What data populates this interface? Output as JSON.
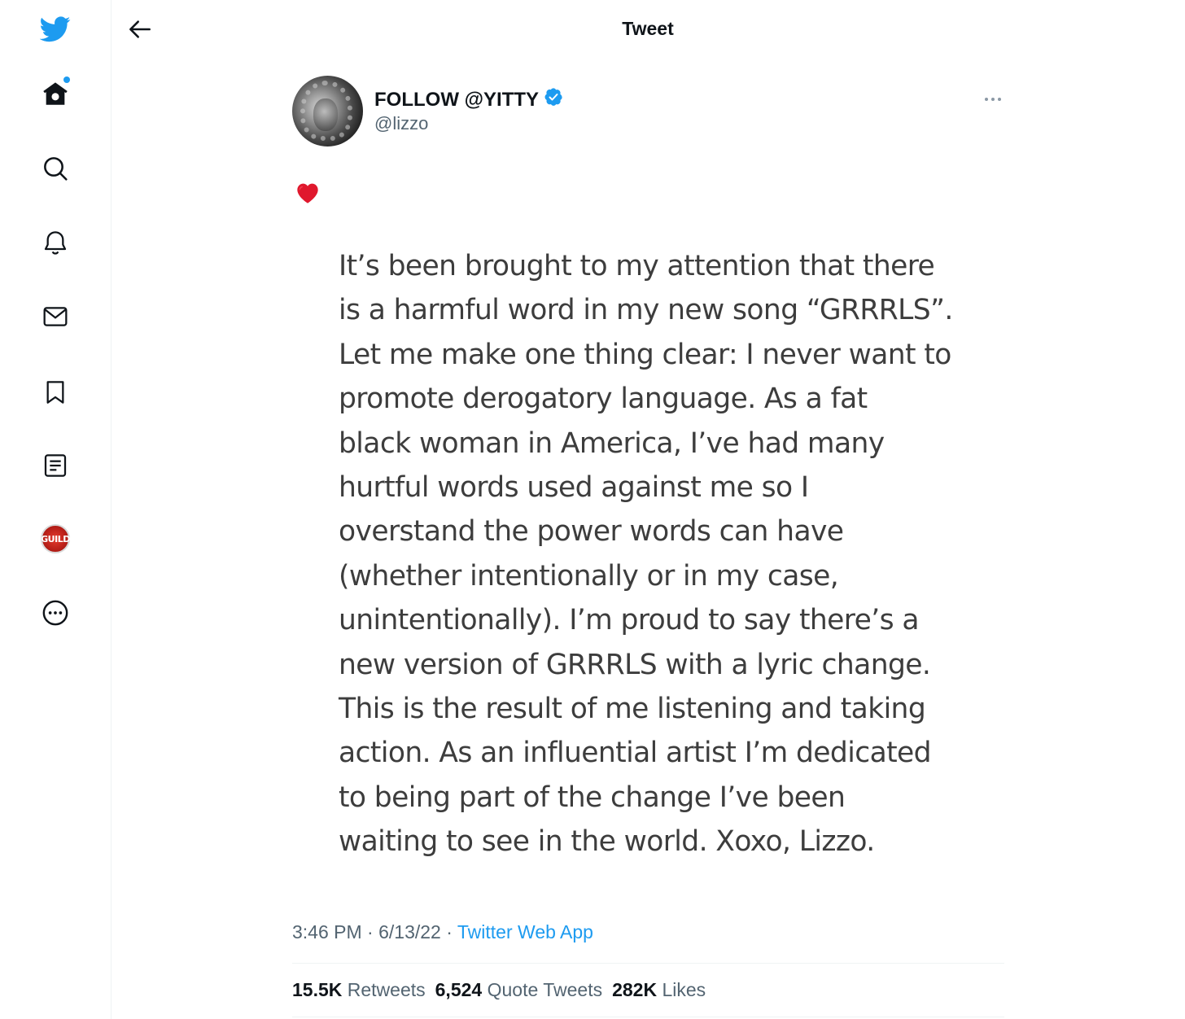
{
  "header": {
    "title": "Tweet"
  },
  "sidebar": {
    "items": [
      {
        "name": "twitter-logo-icon"
      },
      {
        "name": "home-icon"
      },
      {
        "name": "search-icon"
      },
      {
        "name": "notifications-icon"
      },
      {
        "name": "messages-icon"
      },
      {
        "name": "bookmarks-icon"
      },
      {
        "name": "lists-icon"
      },
      {
        "name": "profile-avatar",
        "label": "GUILD"
      },
      {
        "name": "more-icon"
      }
    ]
  },
  "tweet": {
    "display_name": "FOLLOW @YITTY",
    "handle": "@lizzo",
    "emoji": "❤️",
    "lines": [
      "It’s been brought to my attention that there",
      "is a harmful word in my new song “GRRRLS”.",
      "Let me make one thing clear: I never want to",
      "promote derogatory language. As a fat",
      "black woman in America, I’ve had many",
      "hurtful words used against me so I",
      "overstand the power words can have",
      "(whether intentionally or in my case,",
      "unintentionally). I’m proud to say there’s a",
      "new version of GRRRLS with a lyric change.",
      "This is the result of me listening and taking",
      "action. As an influential artist I’m dedicated",
      "to being part of the change I’ve been",
      "waiting to see in the world. Xoxo, Lizzo."
    ],
    "time": "3:46 PM",
    "date": "6/13/22",
    "separator": "·",
    "source": "Twitter Web App",
    "stats": {
      "retweets_count": "15.5K",
      "retweets_label": "Retweets",
      "quotes_count": "6,524",
      "quotes_label": "Quote Tweets",
      "likes_count": "282K",
      "likes_label": "Likes"
    }
  },
  "colors": {
    "accent": "#1d9bf0",
    "text_primary": "#0f1419",
    "text_secondary": "#536471",
    "divider": "#eff3f4"
  }
}
